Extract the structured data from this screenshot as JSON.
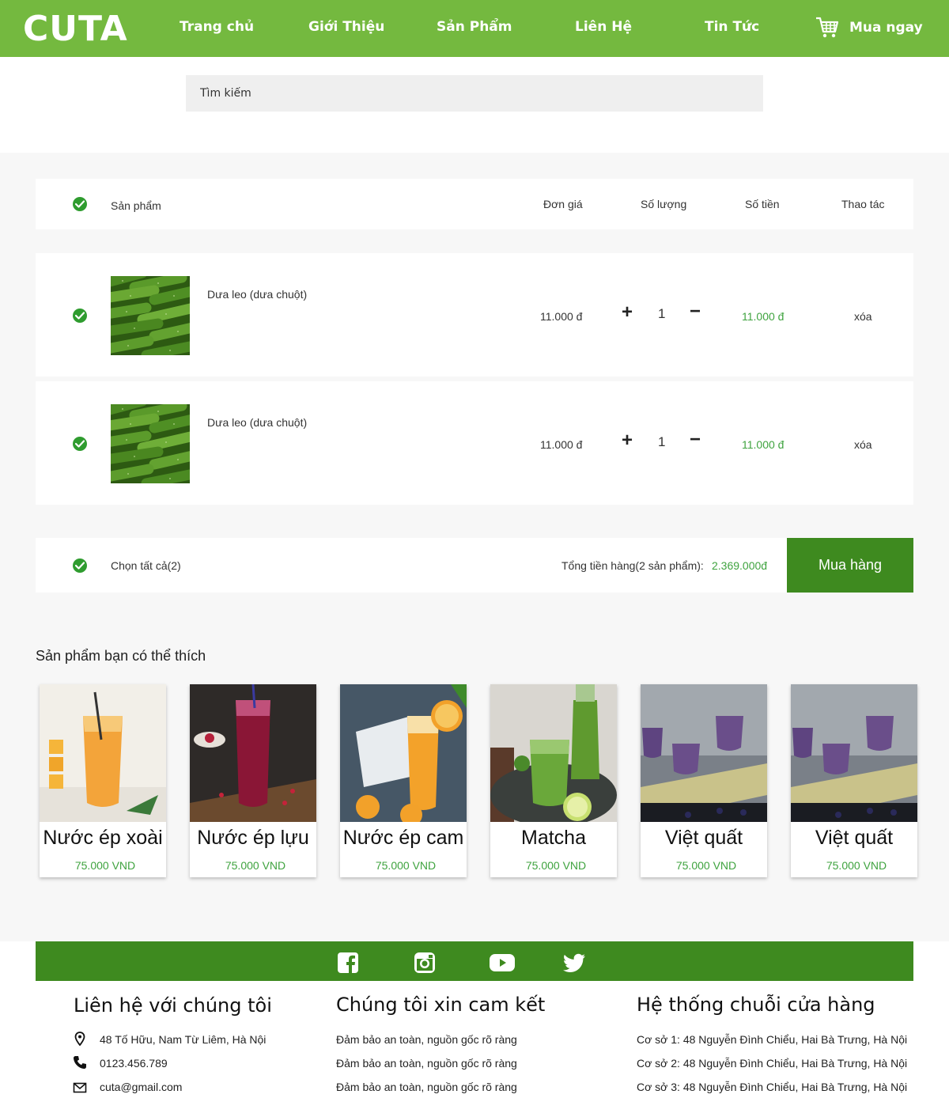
{
  "header": {
    "logo": "CUTA",
    "nav": [
      "Trang chủ",
      "Giới Thiệu",
      "Sản Phẩm",
      "Liên Hệ",
      "Tin Tức"
    ],
    "cart_label": "Mua ngay"
  },
  "search": {
    "placeholder": "Tìm kiếm"
  },
  "cart": {
    "columns": {
      "product": "Sản phẩm",
      "unit_price": "Đơn giá",
      "quantity": "Số lượng",
      "amount": "Số tiền",
      "action": "Thao tác"
    },
    "items": [
      {
        "name": "Dưa leo (dưa chuột)",
        "unit_price": "11.000 đ",
        "quantity": "1",
        "amount": "11.000 đ",
        "action": "xóa"
      },
      {
        "name": "Dưa leo (dưa chuột)",
        "unit_price": "11.000 đ",
        "quantity": "1",
        "amount": "11.000 đ",
        "action": "xóa"
      }
    ],
    "select_all": "Chọn tất cả(2)",
    "total_label": "Tổng tiền hàng(2 sản phẩm):",
    "total_value": "2.369.000đ",
    "buy_button": "Mua hàng"
  },
  "suggestions": {
    "title": "Sản phẩm bạn có thể thích",
    "items": [
      {
        "name": "Nước ép xoài",
        "price": "75.000 VND"
      },
      {
        "name": "Nước ép lựu",
        "price": "75.000 VND"
      },
      {
        "name": "Nước ép cam",
        "price": "75.000 VND"
      },
      {
        "name": "Matcha",
        "price": "75.000 VND"
      },
      {
        "name": "Việt quất",
        "price": "75.000 VND"
      },
      {
        "name": "Việt quất",
        "price": "75.000 VND"
      }
    ]
  },
  "footer": {
    "social_icons": [
      "facebook-icon",
      "instagram-icon",
      "youtube-icon",
      "twitter-icon"
    ],
    "contact": {
      "title": "Liên hệ với chúng tôi",
      "address": "48 Tố Hữu, Nam Từ Liêm, Hà Nội",
      "phone": "0123.456.789",
      "email": "cuta@gmail.com"
    },
    "commit": {
      "title": "Chúng tôi xin cam kết",
      "lines": [
        "Đảm bảo an toàn, nguồn gốc rõ ràng",
        "Đảm bảo an toàn, nguồn gốc rõ ràng",
        "Đảm bảo an toàn, nguồn gốc rõ ràng"
      ]
    },
    "stores": {
      "title": "Hệ thống chuỗi cửa hàng",
      "lines": [
        "Cơ sở 1: 48 Nguyễn Đình Chiểu, Hai Bà Trưng, Hà Nội",
        "Cơ sở 2: 48 Nguyễn Đình Chiểu, Hai Bà Trưng, Hà Nội",
        "Cơ sở 3: 48 Nguyễn Đình Chiểu, Hai Bà Trưng, Hà Nội"
      ]
    }
  },
  "colors": {
    "brand_green": "#74b93f",
    "dark_green": "#3e8a1f",
    "price_green": "#3fa33f"
  }
}
